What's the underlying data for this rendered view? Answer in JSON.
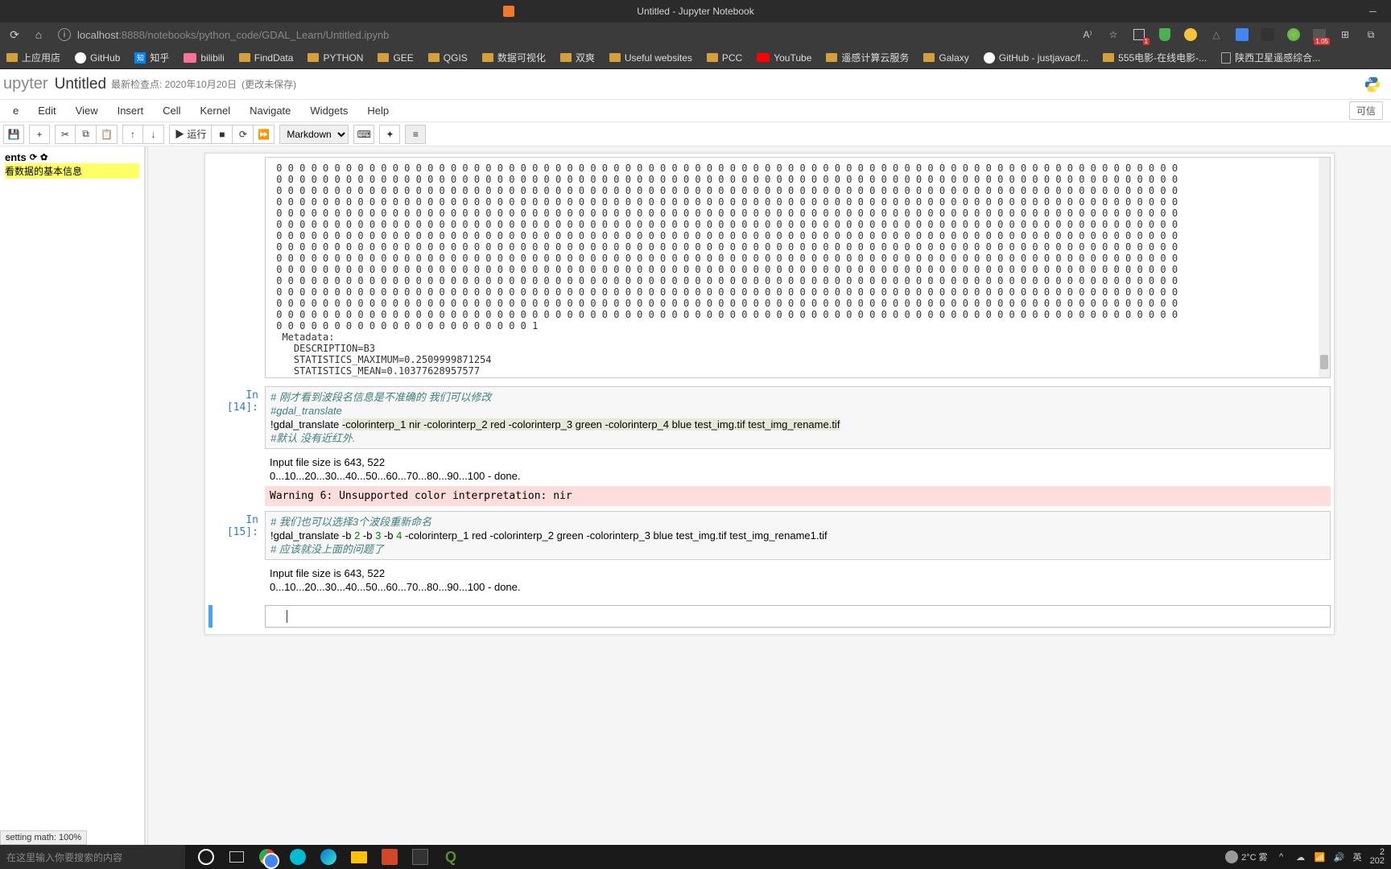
{
  "window": {
    "title": "Untitled - Jupyter Notebook"
  },
  "url": {
    "host": "localhost",
    "port": ":8888",
    "path": "/notebooks/python_code/GDAL_Learn/Untitled.ipynb"
  },
  "addr_icons": {
    "read_aloud": "A⁾",
    "star": "☆",
    "badge1": "1",
    "badge2": "1.05"
  },
  "bookmarks": [
    {
      "label": "上应用店",
      "kind": "folder"
    },
    {
      "label": "知乎",
      "kind": "zhihu"
    },
    {
      "label": "bilibili",
      "kind": "bili"
    },
    {
      "label": "FindData",
      "kind": "folder"
    },
    {
      "label": "PYTHON",
      "kind": "folder"
    },
    {
      "label": "GEE",
      "kind": "folder"
    },
    {
      "label": "QGIS",
      "kind": "folder"
    },
    {
      "label": "数据可视化",
      "kind": "folder"
    },
    {
      "label": "双爽",
      "kind": "folder"
    },
    {
      "label": "Useful websites",
      "kind": "folder"
    },
    {
      "label": "PCC",
      "kind": "folder"
    },
    {
      "label": "遥感计算云服务",
      "kind": "folder"
    },
    {
      "label": "Galaxy",
      "kind": "folder"
    },
    {
      "label": "GitHub - justjavac/f...",
      "kind": "github"
    },
    {
      "label": "555电影-在线电影-...",
      "kind": "folder"
    },
    {
      "label": "陕西卫星遥感综合...",
      "kind": "txt"
    }
  ],
  "bookmarks_extra": {
    "github": "GitHub",
    "youtube": "YouTube"
  },
  "jupyter": {
    "logo": "upyter",
    "title": "Untitled",
    "checkpoint": "最新检查点: 2020年10月20日",
    "saved": "(更改未保存)",
    "trusted": "可信"
  },
  "menu": [
    "File",
    "Edit",
    "View",
    "Insert",
    "Cell",
    "Kernel",
    "Navigate",
    "Widgets",
    "Help"
  ],
  "menu_first": "e",
  "toolbar": {
    "run": "▶ 运行",
    "cell_type": "Markdown"
  },
  "toc": {
    "title": "ents",
    "item1": "看数据的基本信息"
  },
  "output_zeros_lines": 15,
  "output_meta": {
    "metadata": "  Metadata:",
    "desc": "    DESCRIPTION=B3",
    "max": "    STATISTICS_MAXIMUM=0.2509999871254",
    "mean": "    STATISTICS_MEAN=0.10377628957577"
  },
  "cell14": {
    "prompt": "In [14]:",
    "c1": "# 刚才看到波段名信息是不准确的 我们可以修改",
    "c2": "#gdal_translate",
    "cmd_pre": "!gdal_translate ",
    "cmd_hl": "-colorinterp_1 nir -colorinterp_2 red -colorinterp_3 green -colorinterp_4 blue test_img.tif test_img_rename.tif",
    "c3": "#默认 没有近红外.",
    "out1": "Input file size is 643, 522",
    "out2": "0...10...20...30...40...50...60...70...80...90...100 - done.",
    "err": "Warning 6: Unsupported color interpretation: nir"
  },
  "cell15": {
    "prompt": "In [15]:",
    "c1": "# 我们也可以选择3个波段重新命名",
    "cmd_a": "!gdal_translate -b ",
    "n2": "2",
    "cmd_b": " -b ",
    "n3": "3",
    "n4": "4",
    "cmd_c": "  -colorinterp_1 red -colorinterp_2 green -colorinterp_3 blue test_img.tif test_img_rename1.tif",
    "c2": "# 应该就没上面的问题了",
    "out1": "Input file size is 643, 522",
    "out2": "0...10...20...30...40...50...60...70...80...90...100 - done."
  },
  "math": "setting math: 100%",
  "taskbar": {
    "search": "在这里输入你要搜索的内容",
    "weather": "2°C  雾",
    "ime": "英",
    "time_top": "2",
    "time_bottom": "202"
  }
}
